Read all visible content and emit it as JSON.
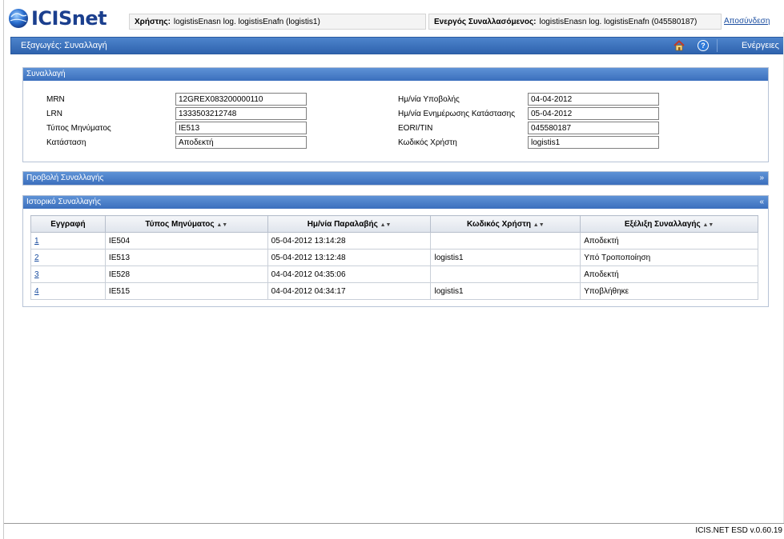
{
  "header": {
    "logo_text": "ICISnet",
    "user_label": "Χρήστης:",
    "user_value": "logistisEnasn log. logistisEnafn (logistis1)",
    "active_label": "Ενεργός Συναλλασόμενος:",
    "active_value": "logistisEnasn log. logistisEnafn (045580187)",
    "logout": "Αποσύνδεση"
  },
  "navbar": {
    "title": "Εξαγωγές: Συναλλαγή",
    "actions": "Ενέργειες",
    "home_icon": "home-icon",
    "help_icon": "help-icon"
  },
  "transaction": {
    "title": "Συναλλαγή",
    "mrn_label": "MRN",
    "mrn_value": "12GREX083200000110",
    "lrn_label": "LRN",
    "lrn_value": "1333503212748",
    "msgtype_label": "Τύπος Μηνύματος",
    "msgtype_value": "IE513",
    "status_label": "Κατάσταση",
    "status_value": "Αποδεκτή",
    "submit_date_label": "Ημ/νία Υποβολής",
    "submit_date_value": "04-04-2012",
    "update_date_label": "Ημ/νία Ενημέρωσης Κατάστασης",
    "update_date_value": "05-04-2012",
    "eori_label": "EORI/TIN",
    "eori_value": "045580187",
    "usercode_label": "Κωδικός Χρήστη",
    "usercode_value": "logistis1"
  },
  "view_panel": {
    "title": "Προβολή Συναλλαγής",
    "arrow": "»"
  },
  "history": {
    "title": "Ιστορικό Συναλλαγής",
    "arrow": "«",
    "columns": [
      "Εγγραφή",
      "Τύπος Μηνύματος",
      "Ημ/νία Παραλαβής",
      "Κωδικός Χρήστη",
      "Εξέλιξη Συναλλαγής"
    ],
    "rows": [
      {
        "id": "1",
        "type": "IE504",
        "date": "05-04-2012 13:14:28",
        "user": "",
        "status": "Αποδεκτή"
      },
      {
        "id": "2",
        "type": "IE513",
        "date": "05-04-2012 13:12:48",
        "user": "logistis1",
        "status": "Υπό Τροποποίηση"
      },
      {
        "id": "3",
        "type": "IE528",
        "date": "04-04-2012 04:35:06",
        "user": "",
        "status": "Αποδεκτή"
      },
      {
        "id": "4",
        "type": "IE515",
        "date": "04-04-2012 04:34:17",
        "user": "logistis1",
        "status": "Υποβλήθηκε"
      }
    ]
  },
  "footer": {
    "version": "ICIS.NET ESD v.0.60.19"
  }
}
